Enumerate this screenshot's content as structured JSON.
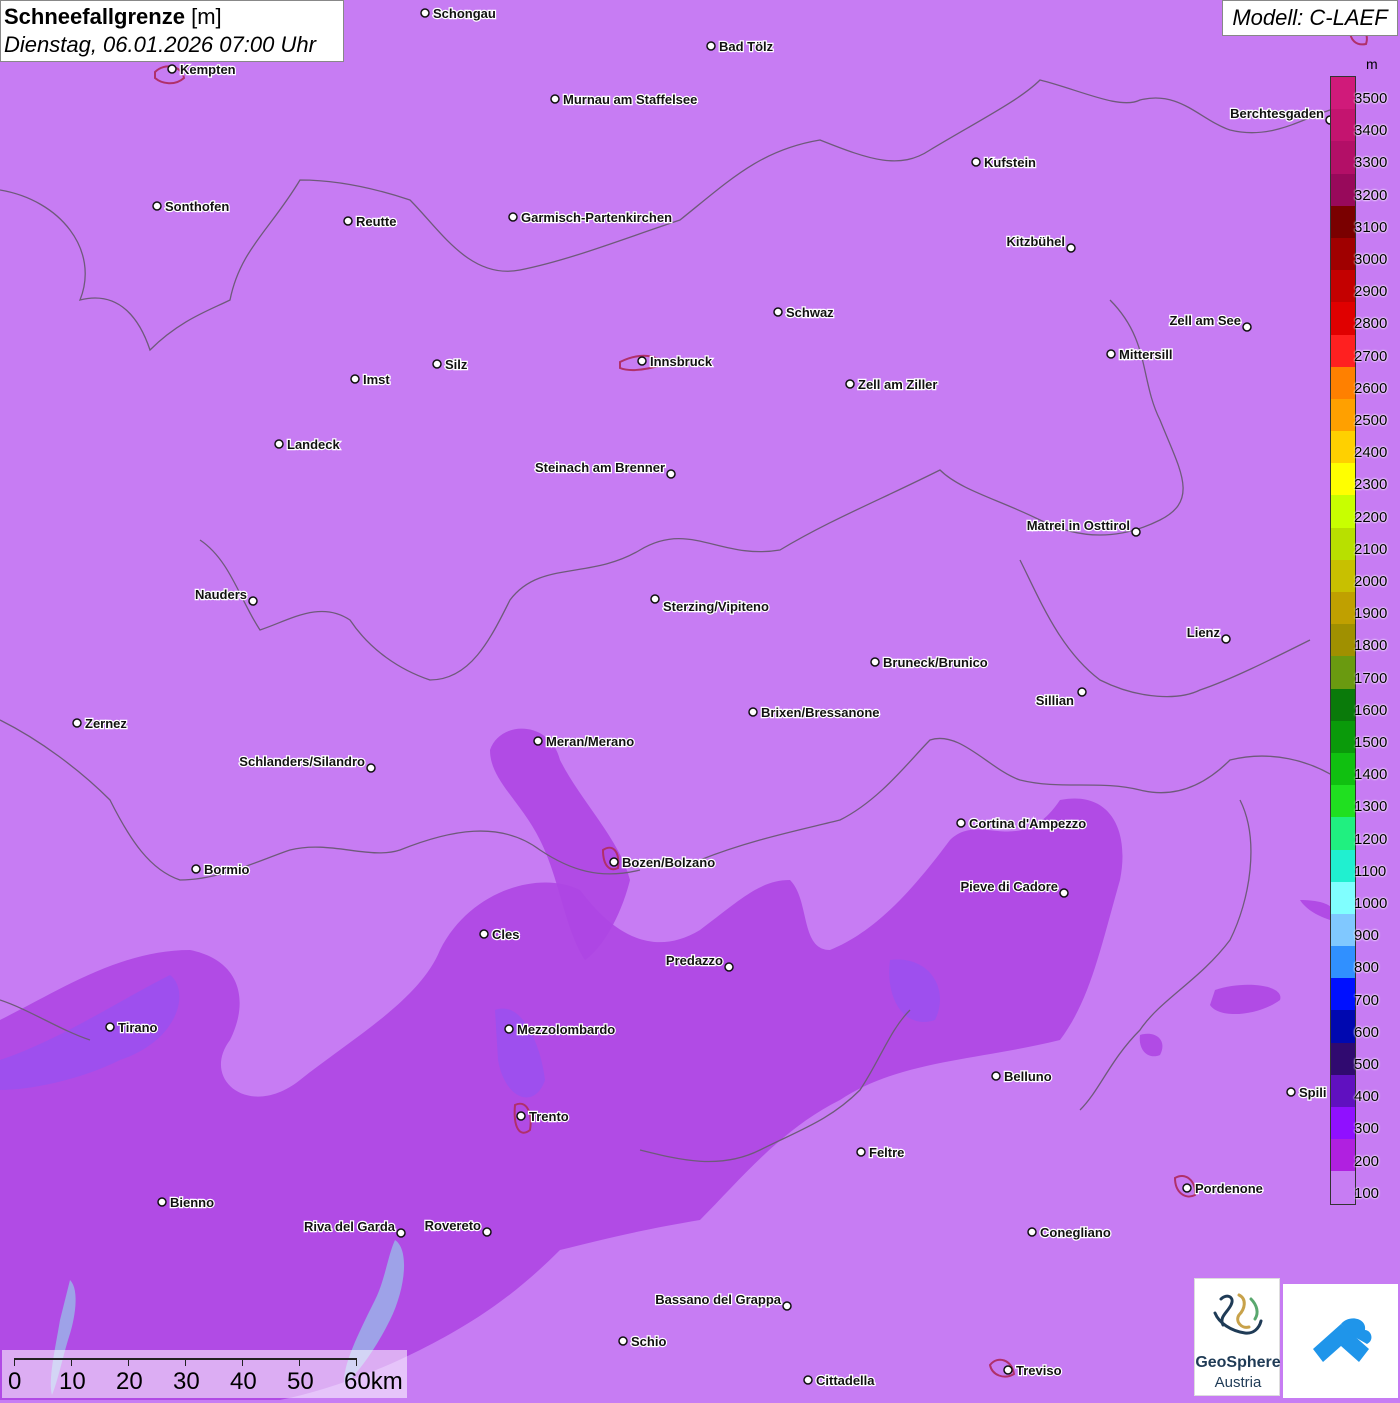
{
  "title": {
    "main": "Schneefallgrenze",
    "unit": "[m]",
    "datetime": "Dienstag, 06.01.2026 07:00 Uhr"
  },
  "model": "Modell: C-LAEF",
  "legend": {
    "unit": "m",
    "levels": [
      {
        "label": "3500",
        "color": "#d01a7a"
      },
      {
        "label": "3400",
        "color": "#c4146f"
      },
      {
        "label": "3300",
        "color": "#b30f67"
      },
      {
        "label": "3200",
        "color": "#98095b"
      },
      {
        "label": "3100",
        "color": "#7a0000"
      },
      {
        "label": "3000",
        "color": "#a00000"
      },
      {
        "label": "2900",
        "color": "#c40000"
      },
      {
        "label": "2800",
        "color": "#e00000"
      },
      {
        "label": "2700",
        "color": "#ff2020"
      },
      {
        "label": "2600",
        "color": "#ff8000"
      },
      {
        "label": "2500",
        "color": "#ffa000"
      },
      {
        "label": "2400",
        "color": "#ffd000"
      },
      {
        "label": "2300",
        "color": "#ffff00"
      },
      {
        "label": "2200",
        "color": "#c8ff00"
      },
      {
        "label": "2100",
        "color": "#b8e000"
      },
      {
        "label": "2000",
        "color": "#c8c000"
      },
      {
        "label": "1900",
        "color": "#c0a000"
      },
      {
        "label": "1800",
        "color": "#a09000"
      },
      {
        "label": "1700",
        "color": "#6a9a10"
      },
      {
        "label": "1600",
        "color": "#0a7a0a"
      },
      {
        "label": "1500",
        "color": "#0a9a0a"
      },
      {
        "label": "1400",
        "color": "#10c010"
      },
      {
        "label": "1300",
        "color": "#20e020"
      },
      {
        "label": "1200",
        "color": "#20f080"
      },
      {
        "label": "1100",
        "color": "#20f0d0"
      },
      {
        "label": "1000",
        "color": "#80ffff"
      },
      {
        "label": "900",
        "color": "#80c8ff"
      },
      {
        "label": "800",
        "color": "#3090ff"
      },
      {
        "label": "700",
        "color": "#0010ff"
      },
      {
        "label": "600",
        "color": "#0008b0"
      },
      {
        "label": "500",
        "color": "#300a70"
      },
      {
        "label": "400",
        "color": "#6010c0"
      },
      {
        "label": "300",
        "color": "#9010ff"
      },
      {
        "label": "200",
        "color": "#b020e0"
      },
      {
        "label": "100",
        "color": "#c77cf3"
      }
    ]
  },
  "map": {
    "background_color": "#c77cf3",
    "band_colors": [
      "#ae46e3",
      "#9c30d6",
      "#9a50f0"
    ],
    "cities": [
      {
        "name": "Schongau"
      },
      {
        "name": "Kempten"
      },
      {
        "name": "Bad Tölz"
      },
      {
        "name": "Murnau am Staffelsee"
      },
      {
        "name": "Berchtesgaden"
      },
      {
        "name": "Kufstein"
      },
      {
        "name": "Sonthofen"
      },
      {
        "name": "Reutte"
      },
      {
        "name": "Garmisch-Partenkirchen"
      },
      {
        "name": "Kitzbühel"
      },
      {
        "name": "Schwaz"
      },
      {
        "name": "Zell am See"
      },
      {
        "name": "Mittersill"
      },
      {
        "name": "Innsbruck"
      },
      {
        "name": "Silz"
      },
      {
        "name": "Imst"
      },
      {
        "name": "Zell am Ziller"
      },
      {
        "name": "Landeck"
      },
      {
        "name": "Steinach am Brenner"
      },
      {
        "name": "Matrei in Osttirol"
      },
      {
        "name": "Nauders"
      },
      {
        "name": "Sterzing/Vipiteno"
      },
      {
        "name": "Lienz"
      },
      {
        "name": "Bruneck/Brunico"
      },
      {
        "name": "Sillian"
      },
      {
        "name": "Brixen/Bressanone"
      },
      {
        "name": "Zernez"
      },
      {
        "name": "Meran/Merano"
      },
      {
        "name": "Schlanders/Silandro"
      },
      {
        "name": "Cortina d'Ampezzo"
      },
      {
        "name": "Bormio"
      },
      {
        "name": "Bozen/Bolzano"
      },
      {
        "name": "Pieve di Cadore"
      },
      {
        "name": "Cles"
      },
      {
        "name": "Predazzo"
      },
      {
        "name": "Tirano"
      },
      {
        "name": "Mezzolombardo"
      },
      {
        "name": "Belluno"
      },
      {
        "name": "Spili"
      },
      {
        "name": "Trento"
      },
      {
        "name": "Feltre"
      },
      {
        "name": "Bienno"
      },
      {
        "name": "Pordenone"
      },
      {
        "name": "Riva del Garda"
      },
      {
        "name": "Rovereto"
      },
      {
        "name": "Conegliano"
      },
      {
        "name": "Bassano del Grappa"
      },
      {
        "name": "Schio"
      },
      {
        "name": "Treviso"
      },
      {
        "name": "Cittadella"
      }
    ]
  },
  "scalebar": {
    "labels": [
      "0",
      "10",
      "20",
      "30",
      "40",
      "50",
      "60km"
    ]
  },
  "logos": {
    "geosphere_line1": "GeoSphere",
    "geosphere_line2": "Austria"
  }
}
